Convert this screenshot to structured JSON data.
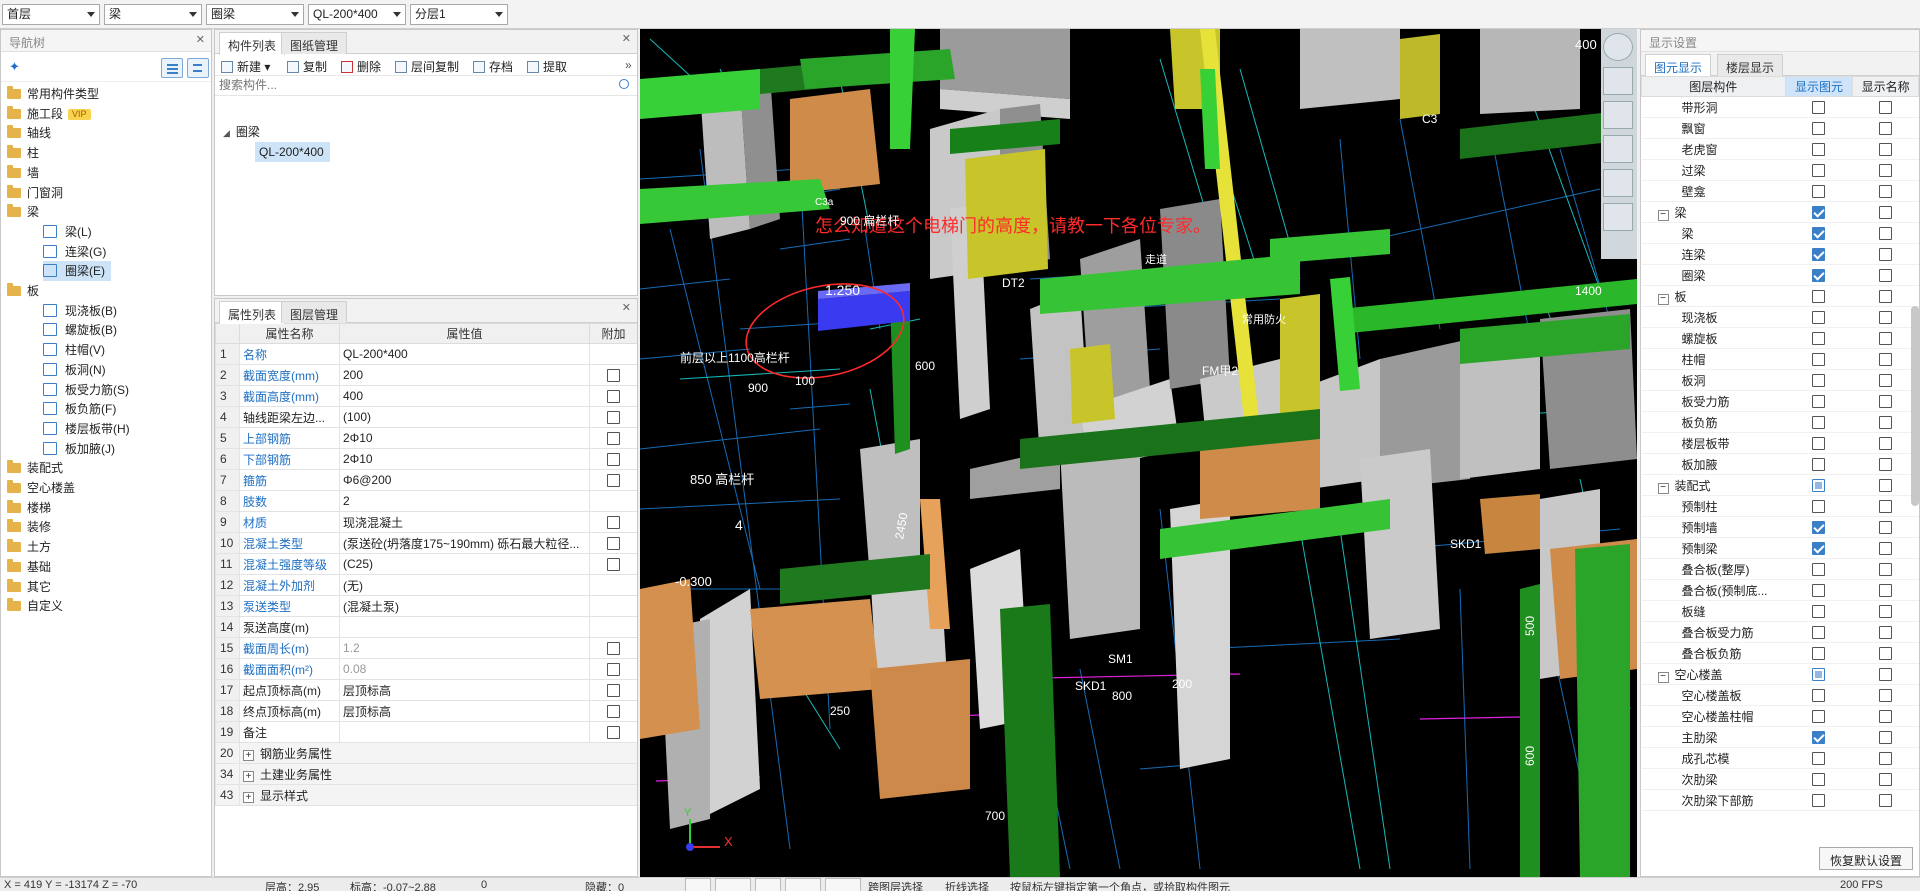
{
  "topbar": {
    "floor": "首层",
    "category": "梁",
    "type": "圈梁",
    "component": "QL-200*400",
    "layer": "分层1"
  },
  "nav": {
    "title": "导航树",
    "items": [
      {
        "label": "常用构件类型"
      },
      {
        "label": "施工段",
        "badge": "VIP"
      },
      {
        "label": "轴线"
      },
      {
        "label": "柱"
      },
      {
        "label": "墙"
      },
      {
        "label": "门窗洞"
      },
      {
        "label": "梁"
      },
      {
        "label": "梁(L)"
      },
      {
        "label": "连梁(G)"
      },
      {
        "label": "圈梁(E)"
      },
      {
        "label": "板"
      },
      {
        "label": "现浇板(B)"
      },
      {
        "label": "螺旋板(B)"
      },
      {
        "label": "柱帽(V)"
      },
      {
        "label": "板洞(N)"
      },
      {
        "label": "板受力筋(S)"
      },
      {
        "label": "板负筋(F)"
      },
      {
        "label": "楼层板带(H)"
      },
      {
        "label": "板加腋(J)"
      },
      {
        "label": "装配式"
      },
      {
        "label": "空心楼盖"
      },
      {
        "label": "楼梯"
      },
      {
        "label": "装修"
      },
      {
        "label": "土方"
      },
      {
        "label": "基础"
      },
      {
        "label": "其它"
      },
      {
        "label": "自定义"
      }
    ]
  },
  "components": {
    "tab_list": "构件列表",
    "tab_drawings": "图纸管理",
    "toolbar": [
      "新建",
      "复制",
      "删除",
      "层间复制",
      "存档",
      "提取"
    ],
    "search_placeholder": "搜索构件...",
    "tree_root": "圈梁",
    "tree_item": "QL-200*400"
  },
  "properties": {
    "tab_props": "属性列表",
    "tab_layers": "图层管理",
    "col_name": "属性名称",
    "col_value": "属性值",
    "col_extra": "附加",
    "rows": [
      {
        "no": "1",
        "name": "名称",
        "value": "QL-200*400",
        "blue": true,
        "check": "none"
      },
      {
        "no": "2",
        "name": "截面宽度(mm)",
        "value": "200",
        "blue": true,
        "check": "off"
      },
      {
        "no": "3",
        "name": "截面高度(mm)",
        "value": "400",
        "blue": true,
        "check": "off"
      },
      {
        "no": "4",
        "name": "轴线距梁左边...",
        "value": "(100)",
        "blue": false,
        "check": "off"
      },
      {
        "no": "5",
        "name": "上部钢筋",
        "value": "2Φ10",
        "blue": true,
        "check": "off"
      },
      {
        "no": "6",
        "name": "下部钢筋",
        "value": "2Φ10",
        "blue": true,
        "check": "off"
      },
      {
        "no": "7",
        "name": "箍筋",
        "value": "Φ6@200",
        "blue": true,
        "check": "off"
      },
      {
        "no": "8",
        "name": "肢数",
        "value": "2",
        "blue": true,
        "check": "none"
      },
      {
        "no": "9",
        "name": "材质",
        "value": "现浇混凝土",
        "blue": true,
        "check": "off"
      },
      {
        "no": "10",
        "name": "混凝土类型",
        "value": "(泵送砼(坍落度175~190mm) 砾石最大粒径...",
        "blue": true,
        "check": "off"
      },
      {
        "no": "11",
        "name": "混凝土强度等级",
        "value": "(C25)",
        "blue": true,
        "check": "off"
      },
      {
        "no": "12",
        "name": "混凝土外加剂",
        "value": "(无)",
        "blue": true,
        "check": "none"
      },
      {
        "no": "13",
        "name": "泵送类型",
        "value": "(混凝土泵)",
        "blue": true,
        "check": "none"
      },
      {
        "no": "14",
        "name": "泵送高度(m)",
        "value": "",
        "blue": false,
        "check": "none"
      },
      {
        "no": "15",
        "name": "截面周长(m)",
        "value": "1.2",
        "blue": true,
        "grey": true,
        "check": "off"
      },
      {
        "no": "16",
        "name": "截面面积(m²)",
        "value": "0.08",
        "blue": true,
        "grey": true,
        "check": "off"
      },
      {
        "no": "17",
        "name": "起点顶标高(m)",
        "value": "层顶标高",
        "blue": false,
        "check": "off"
      },
      {
        "no": "18",
        "name": "终点顶标高(m)",
        "value": "层顶标高",
        "blue": false,
        "check": "off"
      },
      {
        "no": "19",
        "name": "备注",
        "value": "",
        "blue": false,
        "check": "off"
      }
    ],
    "groups": [
      {
        "no": "20",
        "name": "钢筋业务属性"
      },
      {
        "no": "34",
        "name": "土建业务属性"
      },
      {
        "no": "43",
        "name": "显示样式"
      }
    ]
  },
  "viewport": {
    "annotation": "怎么知道这个电梯门的高度，请教一下各位专家。",
    "labels": {
      "l900": "900 扁栏杆",
      "l1250": "1.250",
      "l1100": "前层以上1100高栏杆",
      "l850": "850 高栏杆",
      "l600": "600",
      "l900b": "900",
      "l100": "100",
      "l2450": "2450",
      "l4": "4",
      "lm0300": "-0.300",
      "ldt2": "DT2",
      "lfm": "FM甲2",
      "lskd1": "SKD1",
      "lskd1b": "SKD1",
      "lsm1": "SM1",
      "l800": "800",
      "l200": "200",
      "l1400": "1400",
      "l400": "400",
      "lc3": "C3",
      "l250": "250",
      "l700": "700",
      "l500": "500",
      "l600b": "600",
      "laxisx": "X",
      "laxisy": "Y",
      "lc3a": "C3a",
      "lwalkway": "走道",
      "lscorr": "常用防火"
    }
  },
  "display": {
    "title": "显示设置",
    "tab_elements": "图元显示",
    "tab_floors": "楼层显示",
    "col_layer": "图层构件",
    "col_show": "显示图元",
    "col_name": "显示名称",
    "restore": "恢复默认设置",
    "rows": [
      {
        "label": "带形洞",
        "indent": 2,
        "show": "off",
        "name": "off"
      },
      {
        "label": "飘窗",
        "indent": 2,
        "show": "off",
        "name": "off"
      },
      {
        "label": "老虎窗",
        "indent": 2,
        "show": "off",
        "name": "off"
      },
      {
        "label": "过梁",
        "indent": 2,
        "show": "off",
        "name": "off"
      },
      {
        "label": "壁龛",
        "indent": 2,
        "show": "off",
        "name": "off"
      },
      {
        "label": "梁",
        "indent": 1,
        "group": true,
        "show": "on",
        "name": "off"
      },
      {
        "label": "梁",
        "indent": 2,
        "show": "on",
        "name": "off"
      },
      {
        "label": "连梁",
        "indent": 2,
        "show": "on",
        "name": "off"
      },
      {
        "label": "圈梁",
        "indent": 2,
        "show": "on",
        "name": "off"
      },
      {
        "label": "板",
        "indent": 1,
        "group": true,
        "show": "off",
        "name": "off"
      },
      {
        "label": "现浇板",
        "indent": 2,
        "show": "off",
        "name": "off"
      },
      {
        "label": "螺旋板",
        "indent": 2,
        "show": "off",
        "name": "off"
      },
      {
        "label": "柱帽",
        "indent": 2,
        "show": "off",
        "name": "off"
      },
      {
        "label": "板洞",
        "indent": 2,
        "show": "off",
        "name": "off"
      },
      {
        "label": "板受力筋",
        "indent": 2,
        "show": "off",
        "name": "off"
      },
      {
        "label": "板负筋",
        "indent": 2,
        "show": "off",
        "name": "off"
      },
      {
        "label": "楼层板带",
        "indent": 2,
        "show": "off",
        "name": "off"
      },
      {
        "label": "板加腋",
        "indent": 2,
        "show": "off",
        "name": "off"
      },
      {
        "label": "装配式",
        "indent": 1,
        "group": true,
        "show": "partial",
        "name": "off"
      },
      {
        "label": "预制柱",
        "indent": 2,
        "show": "off",
        "name": "off"
      },
      {
        "label": "预制墙",
        "indent": 2,
        "show": "on",
        "name": "off"
      },
      {
        "label": "预制梁",
        "indent": 2,
        "show": "on",
        "name": "off"
      },
      {
        "label": "叠合板(整厚)",
        "indent": 2,
        "show": "off",
        "name": "off"
      },
      {
        "label": "叠合板(预制底...",
        "indent": 2,
        "show": "off",
        "name": "off"
      },
      {
        "label": "板缝",
        "indent": 2,
        "show": "off",
        "name": "off"
      },
      {
        "label": "叠合板受力筋",
        "indent": 2,
        "show": "off",
        "name": "off"
      },
      {
        "label": "叠合板负筋",
        "indent": 2,
        "show": "off",
        "name": "off"
      },
      {
        "label": "空心楼盖",
        "indent": 1,
        "group": true,
        "show": "partial",
        "name": "off"
      },
      {
        "label": "空心楼盖板",
        "indent": 2,
        "show": "off",
        "name": "off"
      },
      {
        "label": "空心楼盖柱帽",
        "indent": 2,
        "show": "off",
        "name": "off"
      },
      {
        "label": "主肋梁",
        "indent": 2,
        "show": "on",
        "name": "off"
      },
      {
        "label": "成孔芯模",
        "indent": 2,
        "show": "off",
        "name": "off"
      },
      {
        "label": "次肋梁",
        "indent": 2,
        "show": "off",
        "name": "off"
      },
      {
        "label": "次肋梁下部筋",
        "indent": 2,
        "show": "off",
        "name": "off"
      }
    ]
  },
  "status": {
    "coords": "X = 419 Y = -13174 Z = -70",
    "floor_height": "层高：2.95",
    "elevation": "标高：-0.07~2.88",
    "zero": "0",
    "hidden": "隐藏：0",
    "btn_layer_select": "跨图层选择",
    "btn_polyline_select": "折线选择",
    "hint": "按鼠标左键指定第一个角点，或拾取构件图元",
    "fps": "200 FPS"
  },
  "colors": {
    "accent": "#1d6fc4",
    "wall_grey": "#b9b9b9",
    "beam_green": "#2fb52f",
    "wall_orange": "#d18e4d",
    "door_yellow": "#c8c52a",
    "selected_beam": "#3a3af0",
    "annotation_red": "#ff2a2a"
  }
}
